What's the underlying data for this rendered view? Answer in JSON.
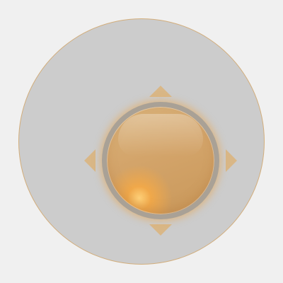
{
  "controls": {
    "directions": [
      "up",
      "down",
      "left",
      "right"
    ],
    "center": "select"
  },
  "colors": {
    "background": "#f0f0f0",
    "pad_fill": "#cccccc",
    "pad_border": "#d2ad7b",
    "arrow": "#d9b787",
    "button_main": "#d3a46a",
    "button_glow": "#e8a550"
  },
  "icons": {
    "up": "triangle-up-icon",
    "down": "triangle-down-icon",
    "left": "triangle-left-icon",
    "right": "triangle-right-icon"
  }
}
